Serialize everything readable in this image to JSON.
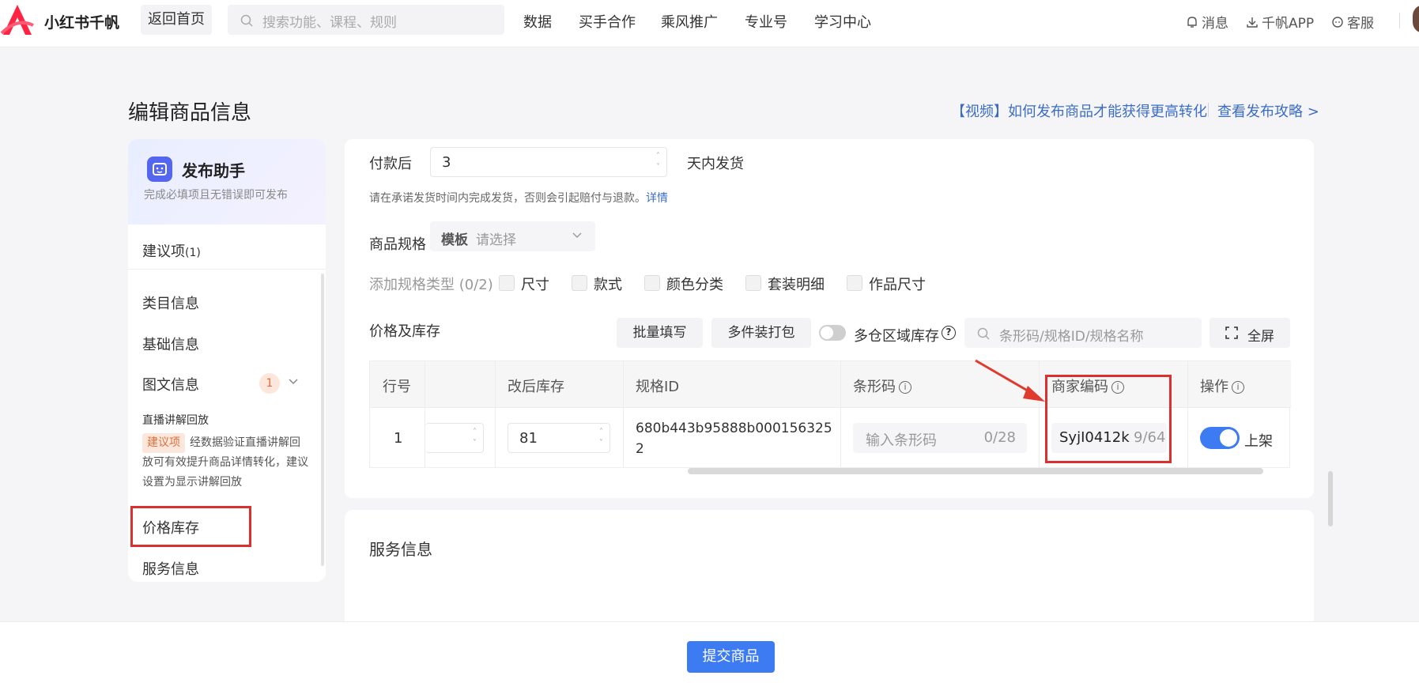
{
  "topbar": {
    "app_name": "小红书千帆",
    "home_label": "返回首页",
    "search_placeholder": "搜索功能、课程、规则",
    "nav": [
      "数据",
      "买手合作",
      "乘风推广",
      "专业号",
      "学习中心"
    ],
    "utils": {
      "messages": "消息",
      "app": "千帆APP",
      "service": "客服"
    }
  },
  "page": {
    "title": "编辑商品信息",
    "video_link": "【视频】如何发布商品才能获得更高转化",
    "guide_link": "查看发布攻略 >"
  },
  "sidebar": {
    "assistant_title": "发布助手",
    "assistant_sub": "完成必填项且无错误即可发布",
    "suggest_label": "建议项",
    "suggest_count": "(1)",
    "items": [
      "类目信息",
      "基础信息",
      "图文信息",
      "价格库存",
      "服务信息"
    ],
    "image_text_badge": "1",
    "sub_head": "直播讲解回放",
    "sub_tag": "建议项",
    "sub_desc": "经数据验证直播讲解回放可有效提升商品详情转化，建议设置为显示讲解回放"
  },
  "shipping": {
    "after_payment_label": "付款后",
    "days_value": "3",
    "days_suffix": "天内发货",
    "hint": "请在承诺发货时间内完成发货，否则会引起赔付与退款。",
    "hint_link": "详情"
  },
  "spec": {
    "label": "商品规格",
    "template": "模板",
    "placeholder": "请选择",
    "add_label": "添加规格类型 (0/2)",
    "types": [
      "尺寸",
      "款式",
      "颜色分类",
      "套装明细",
      "作品尺寸"
    ]
  },
  "price_stock": {
    "label": "价格及库存",
    "batch_fill": "批量填写",
    "multi_pack": "多件装打包",
    "multi_warehouse": "多仓区域库存",
    "search_placeholder": "条形码/规格ID/规格名称",
    "fullscreen": "全屏"
  },
  "table": {
    "headers": {
      "row_no": "行号",
      "stock_after": "改后库存",
      "spec_id": "规格ID",
      "barcode": "条形码",
      "merchant_code": "商家编码",
      "action": "操作"
    },
    "row": {
      "row_no": "1",
      "stock_after": "81",
      "spec_id_line1": "680b443b95888b000156325",
      "spec_id_line2": "2",
      "barcode_placeholder": "输入条形码",
      "barcode_count": "0/28",
      "merchant_code": "SyjI0412k",
      "merchant_count": "9/64",
      "status": "上架"
    }
  },
  "service": {
    "title": "服务信息"
  },
  "footer": {
    "submit": "提交商品"
  },
  "colors": {
    "accent": "#3d7bf2",
    "highlight": "#d93030",
    "link": "#3b6dc7",
    "brand": "#ff2442"
  }
}
